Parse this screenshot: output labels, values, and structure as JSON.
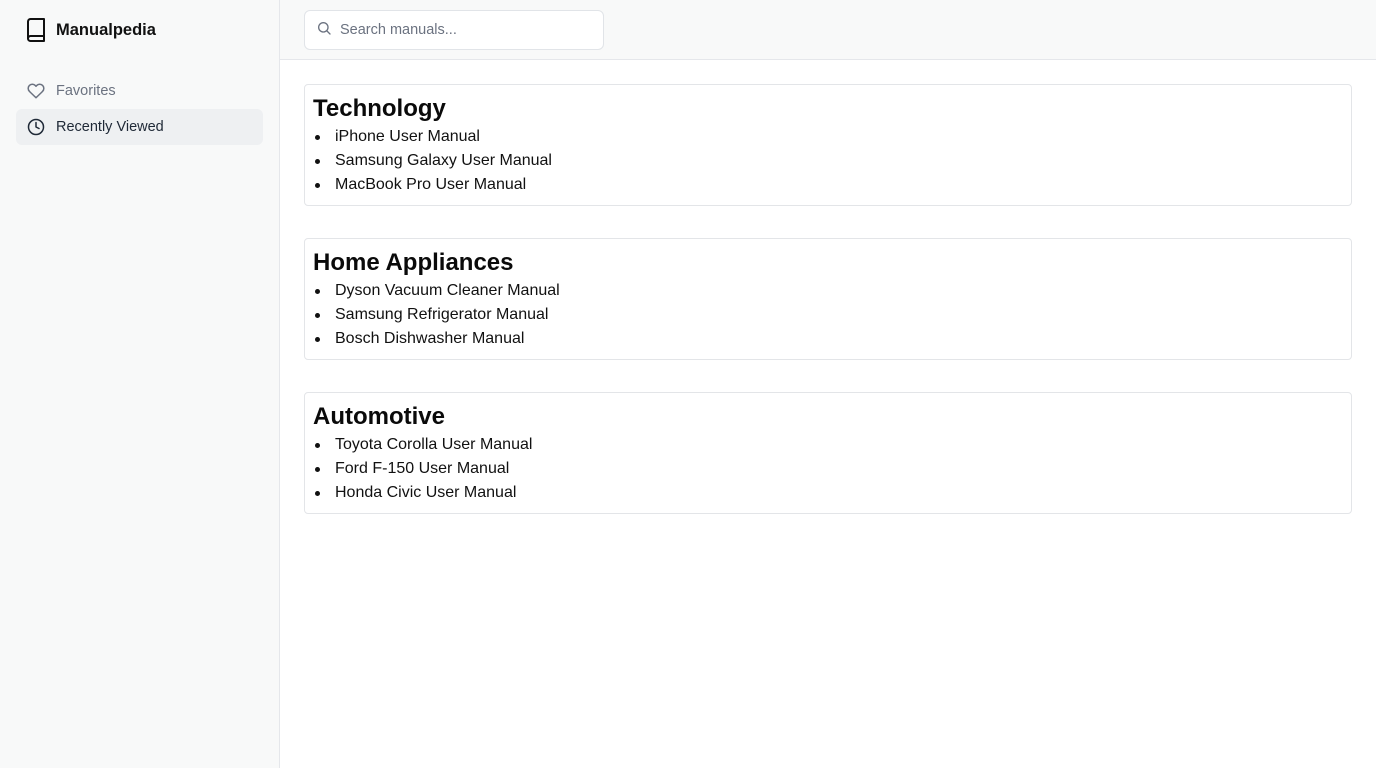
{
  "app": {
    "name": "Manualpedia",
    "logo_icon": "book-icon"
  },
  "sidebar": {
    "items": [
      {
        "label": "Favorites",
        "icon": "heart-icon",
        "active": false
      },
      {
        "label": "Recently Viewed",
        "icon": "clock-icon",
        "active": true
      }
    ]
  },
  "search": {
    "placeholder": "Search manuals...",
    "value": "",
    "icon": "search-icon"
  },
  "categories": [
    {
      "title": "Technology",
      "items": [
        "iPhone User Manual",
        "Samsung Galaxy User Manual",
        "MacBook Pro User Manual"
      ]
    },
    {
      "title": "Home Appliances",
      "items": [
        "Dyson Vacuum Cleaner Manual",
        "Samsung Refrigerator Manual",
        "Bosch Dishwasher Manual"
      ]
    },
    {
      "title": "Automotive",
      "items": [
        "Toyota Corolla User Manual",
        "Ford F-150 User Manual",
        "Honda Civic User Manual"
      ]
    }
  ],
  "colors": {
    "sidebar_bg": "#f8f9f9",
    "active_item_bg": "#eef0f2",
    "muted_text": "#6b7280",
    "border": "#e5e7eb"
  }
}
